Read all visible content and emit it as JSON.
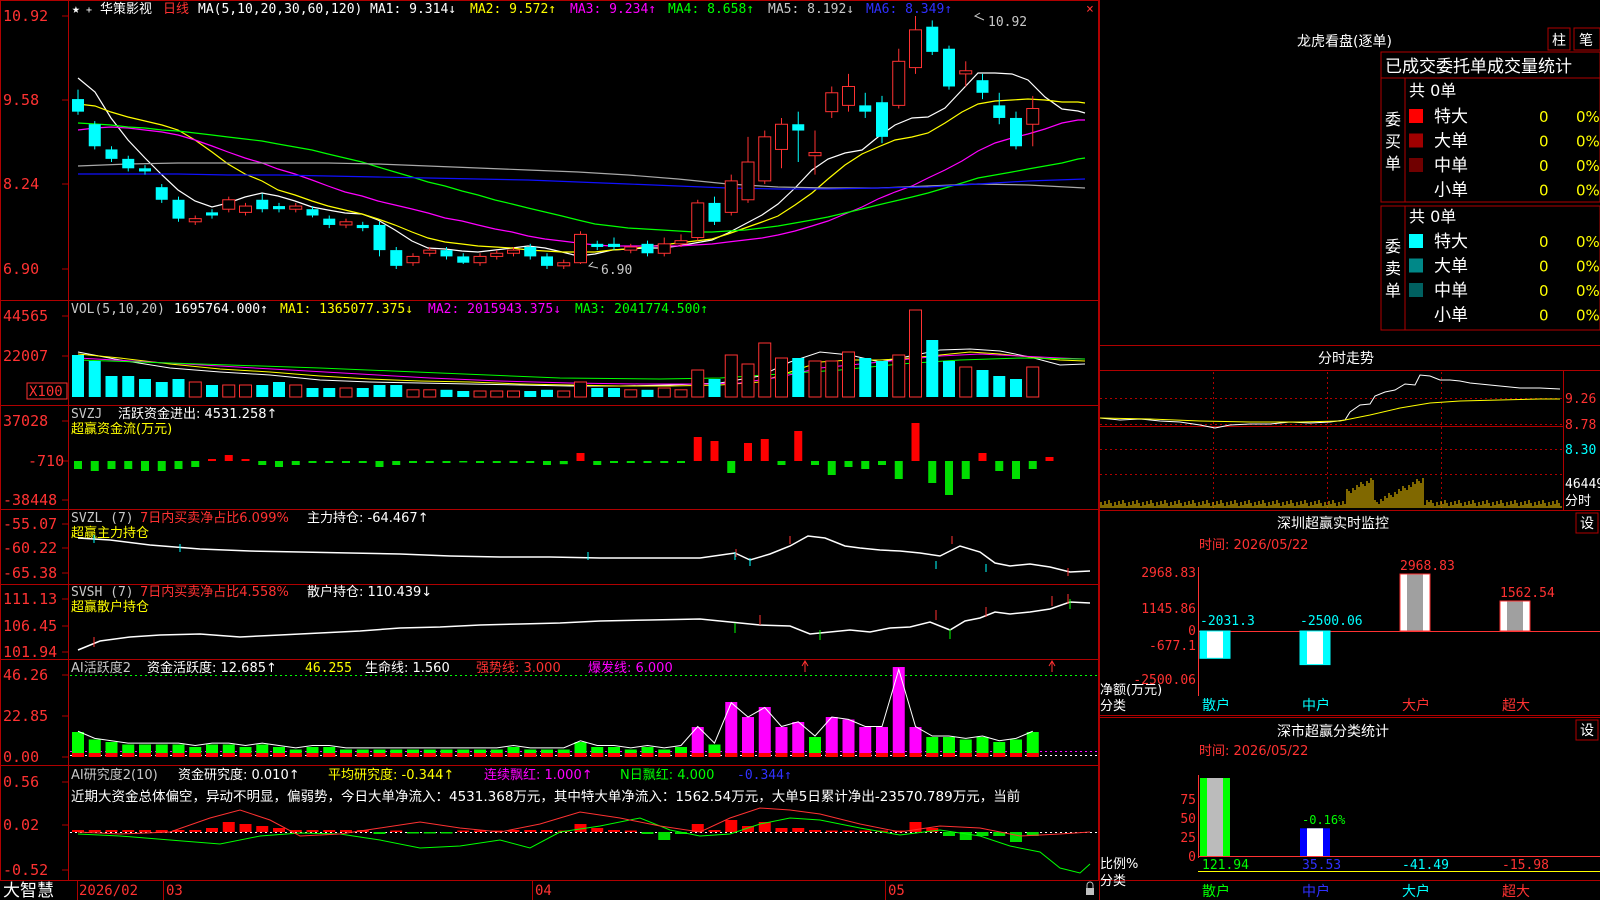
{
  "colors": {
    "up": "#ff3232",
    "down": "#00ffff",
    "frame": "#b00000",
    "ma1": "#ffffff",
    "ma2": "#ffff00",
    "ma3": "#ff00ff",
    "ma4": "#00ff00",
    "ma5": "#a0a0a0",
    "ma6": "#0000ff"
  },
  "header": {
    "star": "★",
    "stock_name": "华策影视",
    "period": "日线",
    "ma_label": "MA(5,10,20,30,60,120)",
    "ma1": "MA1: 9.314↓",
    "ma2": "MA2: 9.572↑",
    "ma3": "MA3: 9.234↑",
    "ma4": "MA4: 8.658↑",
    "ma5": "MA5: 8.192↓",
    "ma6": "MA6: 8.349↑"
  },
  "price_axis": [
    "10.92",
    "9.58",
    "8.24",
    "6.90"
  ],
  "price_annotations": {
    "high": "10.92",
    "low": "6.90"
  },
  "vol": {
    "label": "VOL(5,10,20)",
    "value": "1695764.000↑",
    "ma1": "MA1: 1365077.375↓",
    "ma2": "MA2: 2015943.375↓",
    "ma3": "MA3: 2041774.500↑",
    "axis": [
      "44565",
      "22007",
      "X100"
    ]
  },
  "svzj": {
    "name": "SVZJ",
    "text": "活跃资金进出: 4531.258↑",
    "sub": "超赢资金流(万元)",
    "axis": [
      "37028",
      "-710",
      "-38448"
    ]
  },
  "svzl": {
    "name": "SVZL (7)",
    "pct": "7日内买卖净占比6.099%",
    "text": "主力持仓: -64.467↑",
    "sub": "超赢主力持仓",
    "axis": [
      "-55.07",
      "-60.22",
      "-65.38"
    ]
  },
  "svsh": {
    "name": "SVSH (7)",
    "pct": "7日内买卖净占比4.558%",
    "text": "散户持仓: 110.439↓",
    "sub": "超赢散户持仓",
    "axis": [
      "111.13",
      "106.45",
      "101.94"
    ]
  },
  "ai_active": {
    "name": "AI活跃度2",
    "text1": "资金活跃度: 12.685↑",
    "text2": "46.255",
    "text3": "生命线: 1.560",
    "text4": "强势线: 3.000",
    "text5": "爆发线: 6.000",
    "axis": [
      "46.26",
      "22.85",
      "0.00"
    ]
  },
  "ai_research": {
    "name": "AI研究度2(10)",
    "text1": "资金研究度: 0.010↑",
    "text2": "平均研究度: -0.344↑",
    "text3": "连续飘红: 1.000↑",
    "text4": "N日飘红: 4.000",
    "text5": "-0.344↑",
    "sentence": "近期大资金总体偏空，异动不明显，偏弱势，今日大单净流入：4531.368万元，其中特大单净流入：1562.54万元，大单5日累计净出-23570.789万元，当前",
    "axis": [
      "0.56",
      "0.02",
      "-0.52"
    ]
  },
  "bottom": {
    "brand": "大智慧",
    "dates": [
      "2026/02",
      "03",
      "04",
      "05"
    ]
  },
  "lhb": {
    "title": "龙虎看盘(逐单)",
    "btn1": "柱",
    "btn2": "笔",
    "tabs": "已成交委托单成交量统计",
    "buy_total": "共 0单",
    "buy_side": "委买单",
    "sell_total": "共 0单",
    "sell_side": "委卖单",
    "buy_rows": [
      {
        "label": "特大",
        "val": "0",
        "pct": "0%",
        "color": "#ff0000"
      },
      {
        "label": "大单",
        "val": "0",
        "pct": "0%",
        "color": "#a00000"
      },
      {
        "label": "中单",
        "val": "0",
        "pct": "0%",
        "color": "#700000"
      },
      {
        "label": "小单",
        "val": "0",
        "pct": "0%",
        "color": ""
      }
    ],
    "sell_rows": [
      {
        "label": "特大",
        "val": "0",
        "pct": "0%",
        "color": "#00ffff"
      },
      {
        "label": "大单",
        "val": "0",
        "pct": "0%",
        "color": "#008888"
      },
      {
        "label": "中单",
        "val": "0",
        "pct": "0%",
        "color": "#006060"
      },
      {
        "label": "小单",
        "val": "0",
        "pct": "0%",
        "color": ""
      }
    ]
  },
  "intraday": {
    "title": "分时走势",
    "axis": [
      "9.26",
      "8.78",
      "8.30",
      "46449",
      "分时"
    ]
  },
  "sz_monitor": {
    "title": "深圳超赢实时监控",
    "btn": "设",
    "time": "时间: 2026/05/22",
    "axis": [
      "2968.83",
      "1145.86",
      "0",
      "-677.1",
      "-2500.06"
    ],
    "ylabel": "净额(万元)",
    "xlabel": "分类",
    "categories": [
      "散户",
      "中户",
      "大户",
      "超大"
    ],
    "values": [
      -2031.3,
      -2500.06,
      2968.83,
      1562.54
    ],
    "value_labels": [
      "-2031.3",
      "-2500.06",
      "2968.83",
      "1562.54"
    ]
  },
  "sz_class": {
    "title": "深市超赢分类统计",
    "btn": "设",
    "time": "时间: 2026/05/22",
    "axis": [
      "75",
      "50",
      "25",
      "0"
    ],
    "ylabel": "比例%",
    "xlabel": "分类",
    "categories": [
      "散户",
      "中户",
      "大户",
      "超大"
    ],
    "values": [
      121.94,
      35.53,
      -41.49,
      -15.98
    ],
    "value_labels": [
      "121.94",
      "35.53",
      "-41.49",
      "-15.98"
    ],
    "mid_label": "-0.16%"
  }
}
